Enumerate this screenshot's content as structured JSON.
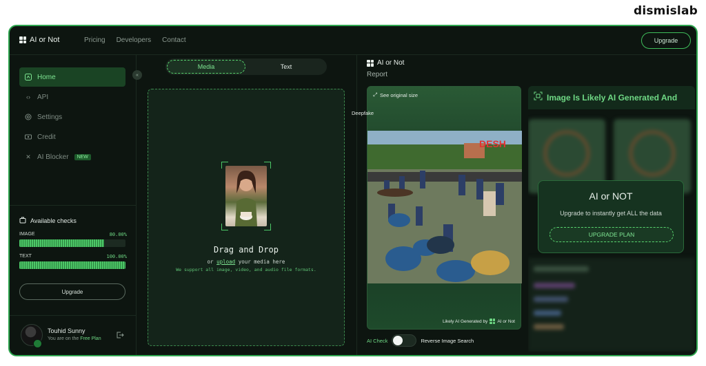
{
  "brand": "dismislab",
  "app": {
    "name": "AI or Not",
    "nav": [
      "Pricing",
      "Developers",
      "Contact"
    ],
    "upgrade_label": "Upgrade"
  },
  "sidebar": {
    "items": [
      {
        "label": "Home",
        "icon": "home-icon",
        "active": true
      },
      {
        "label": "API",
        "icon": "code-icon"
      },
      {
        "label": "Settings",
        "icon": "gear-icon"
      },
      {
        "label": "Credit",
        "icon": "credit-card-icon"
      },
      {
        "label": "AI Blocker",
        "icon": "close-icon",
        "badge": "NEW"
      }
    ],
    "checks": {
      "title": "Available checks",
      "image": {
        "label": "IMAGE",
        "value": "80.00%",
        "fraction": 0.8
      },
      "text": {
        "label": "TEXT",
        "value": "100.00%",
        "fraction": 1.0
      },
      "upgrade_label": "Upgrade"
    },
    "profile": {
      "name": "Touhid Sunny",
      "plan_prefix": "You are on the ",
      "plan_name": "Free Plan"
    }
  },
  "upload": {
    "tabs": [
      "Media",
      "Text"
    ],
    "title": "Drag and Drop",
    "sub_prefix": "or ",
    "sub_link": "upload",
    "sub_suffix": " your media here",
    "note": "We support all image, video, and audio file formats."
  },
  "report": {
    "app_name": "AI or Not",
    "title": "Report",
    "see_original": "See original size",
    "overlay_label": "Deepfake",
    "photo_watermark": "DESH",
    "footer_prefix": "Likely AI Generated by",
    "footer_brand": "AI or Not",
    "toggle_left": "AI Check",
    "toggle_right": "Reverse Image Search",
    "result_title": "Image Is Likely AI Generated And",
    "upsell": {
      "title": "AI or NOT",
      "subtitle": "Upgrade to instantly get ALL the data",
      "button": "UPGRADE PLAN"
    }
  }
}
